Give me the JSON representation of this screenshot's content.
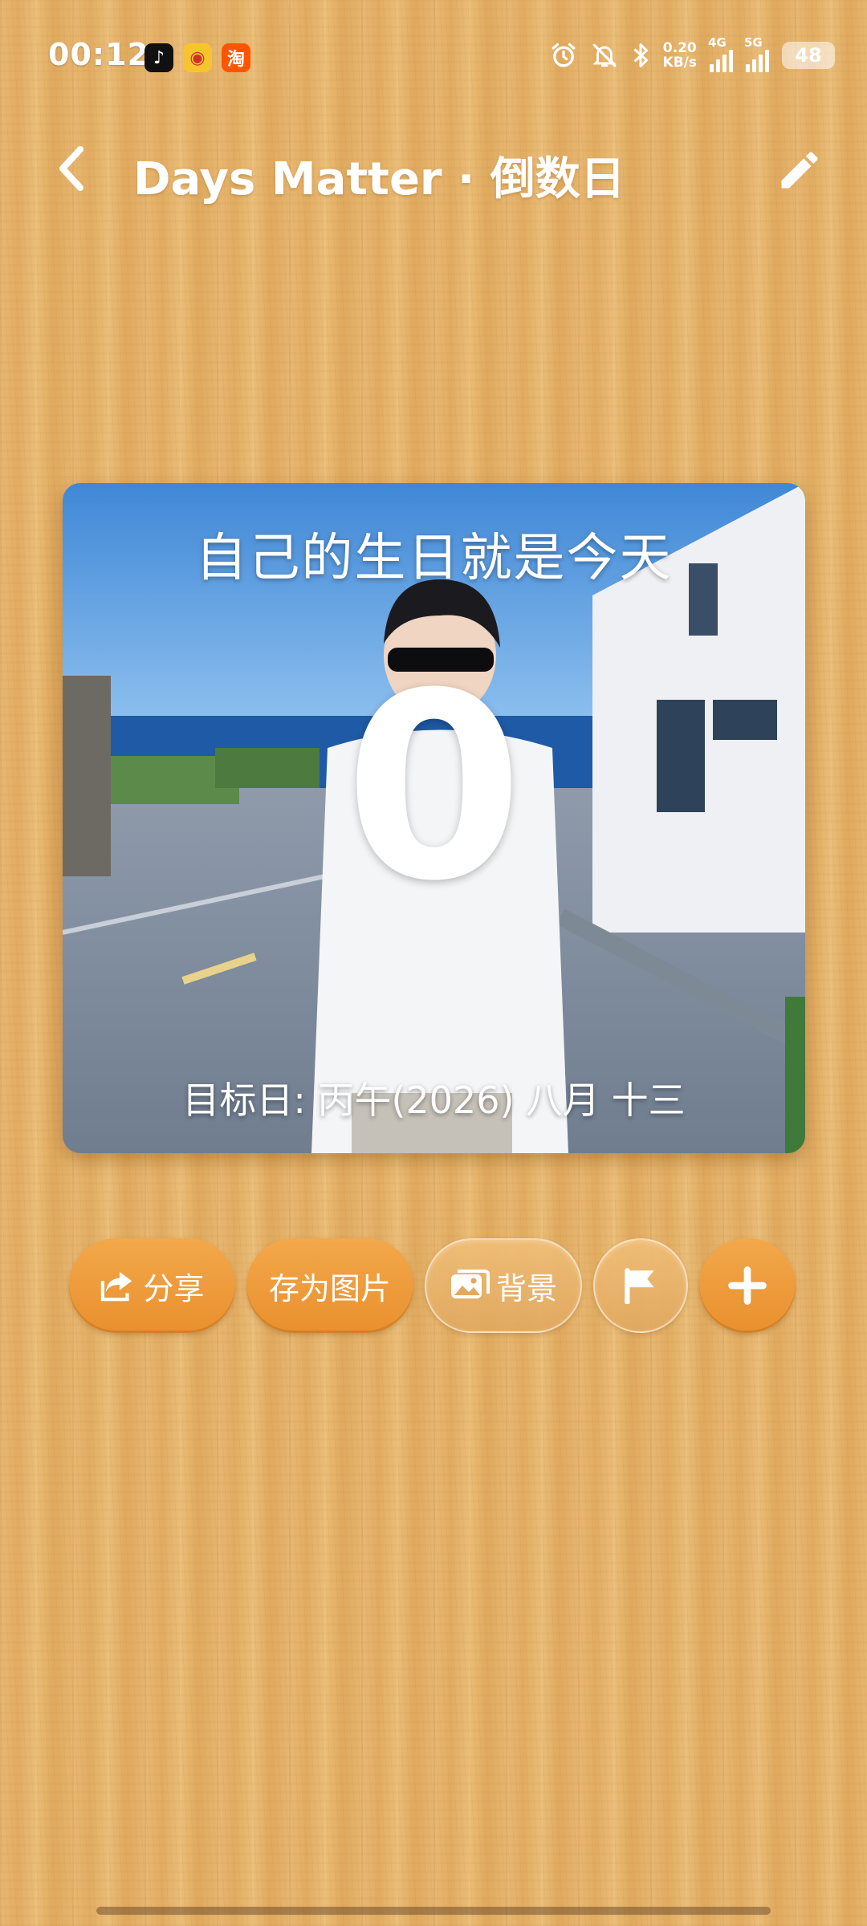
{
  "status_bar": {
    "time": "00:12",
    "apps": [
      {
        "name": "tiktok-icon",
        "glyph": "♪"
      },
      {
        "name": "weibo-icon",
        "glyph": "◉"
      },
      {
        "name": "taobao-icon",
        "glyph": "淘"
      }
    ],
    "net_speed_value": "0.20",
    "net_speed_unit": "KB/s",
    "signal_1": "4G",
    "signal_2": "5G",
    "battery": "48"
  },
  "header": {
    "title": "Days Matter · 倒数日"
  },
  "card": {
    "event_title": "自己的生日就是今天",
    "days": "0",
    "target_date": "目标日: 丙午(2026) 八月 十三"
  },
  "actions": {
    "share_label": "分享",
    "save_image_label": "存为图片",
    "background_label": "背景"
  },
  "colors": {
    "accent_orange": "#ef9d3d",
    "wood_base": "#e3b068",
    "text_white": "#ffffff"
  }
}
